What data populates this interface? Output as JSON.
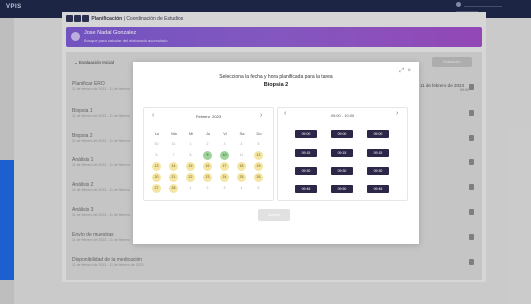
{
  "header": {
    "brand": "VPIS",
    "user_name": "_________________",
    "user_sub": "__________"
  },
  "breadcrumb": {
    "section": "Planificación",
    "page": "Coordinación de Estudios"
  },
  "banner": {
    "name": "Jose Nadal Gonzalez",
    "subtitle": "Busque para calcular del elaborado acumulado"
  },
  "evaluation": {
    "header": "Evaluación Inicial",
    "button_label": "Evaluación"
  },
  "tasks": [
    {
      "title": "Planificar ERO",
      "date": "11 de febrero de 2023 - 11 de febrero"
    },
    {
      "title": "Biopsia 1",
      "date": "11 de febrero de 2023 - 11 de febrero"
    },
    {
      "title": "Biopsia 2",
      "date": "11 de febrero de 2023 - 11 de febrero"
    },
    {
      "title": "Análisis 1",
      "date": "11 de febrero de 2023 - 11 de febrero"
    },
    {
      "title": "Análisis 2",
      "date": "11 de febrero de 2023 - 11 de febrero"
    },
    {
      "title": "Análisis 3",
      "date": "11 de febrero de 2023 - 11 de febrero"
    },
    {
      "title": "Envío de muestras",
      "date": "11 de febrero de 2023 - 11 de febrero"
    },
    {
      "title": "Disponibilidad de la medicación",
      "date": "11 de febrero de 2023 - 11 de febrero de 2023"
    }
  ],
  "right_info": {
    "date": "11 de febrero de 2023",
    "time": "09:00"
  },
  "modal": {
    "title": "Selecciona la fecha y hora planificada para la tarea",
    "task": "Biopsia 2",
    "month_label": "Febrero",
    "year_label": "2023",
    "weekdays": [
      "Lu",
      "Ma",
      "Mi",
      "Ju",
      "Vi",
      "Sa",
      "Do"
    ],
    "time_range": "09:00 - 10:00",
    "slots": [
      "09:00",
      "09:00",
      "09:00",
      "09:15",
      "09:15",
      "09:15",
      "09:30",
      "09:30",
      "09:30",
      "09:45",
      "09:50",
      "09:45"
    ],
    "accept_label": "Aceptar"
  },
  "calendar": {
    "days": [
      [
        "30",
        "31",
        "1",
        "2",
        "3",
        "4",
        "5"
      ],
      [
        "6",
        "7",
        "8",
        "9",
        "10",
        "11",
        "12"
      ],
      [
        "13",
        "14",
        "15",
        "16",
        "17",
        "18",
        "19"
      ],
      [
        "20",
        "21",
        "22",
        "23",
        "24",
        "25",
        "26"
      ],
      [
        "27",
        "28",
        "1",
        "2",
        "3",
        "4",
        "5"
      ]
    ]
  }
}
